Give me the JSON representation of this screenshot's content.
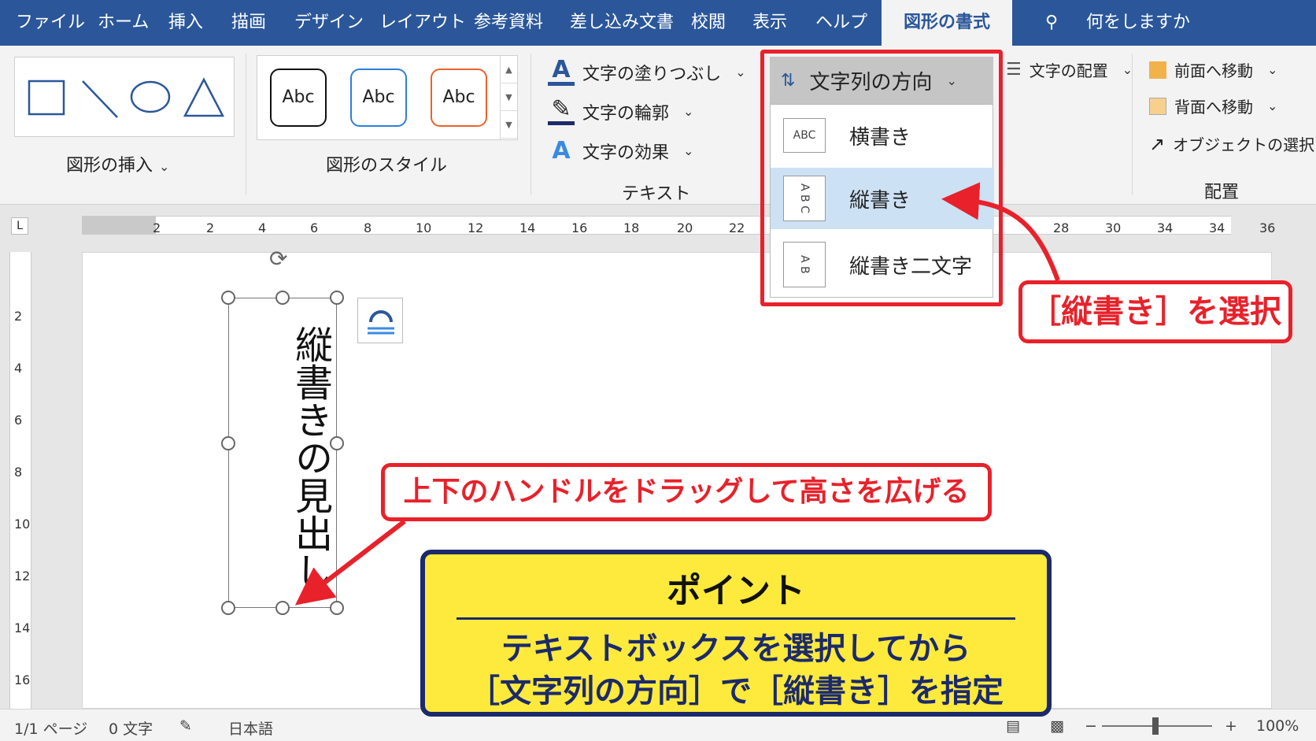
{
  "ribbon_tabs": [
    {
      "label": "ファイル"
    },
    {
      "label": "ホーム"
    },
    {
      "label": "挿入"
    },
    {
      "label": "描画"
    },
    {
      "label": "デザイン"
    },
    {
      "label": "レイアウト"
    },
    {
      "label": "参考資料"
    },
    {
      "label": "差し込み文書"
    },
    {
      "label": "校閲"
    },
    {
      "label": "表示"
    },
    {
      "label": "ヘルプ"
    },
    {
      "label": "図形の書式",
      "active": true
    }
  ],
  "tell_me": "何をしますか",
  "ribbon": {
    "insert_shapes_label": "図形の挿入",
    "shape_styles_label": "図形のスタイル",
    "style_samples": [
      "Abc",
      "Abc",
      "Abc"
    ],
    "text_group_label": "テキスト",
    "text_fill": "文字の塗りつぶし",
    "text_outline": "文字の輪郭",
    "text_effects": "文字の効果",
    "text_direction": "文字列の方向",
    "align_text": "文字の配置",
    "arrange_label": "配置",
    "bring_forward": "前面へ移動",
    "send_backward": "背面へ移動",
    "selection_pane": "オブジェクトの選択"
  },
  "dropdown": {
    "items": [
      {
        "label": "横書き",
        "icon_text": "ABC"
      },
      {
        "label": "縦書き",
        "icon_text": "A B C",
        "selected": true
      },
      {
        "label": "縦書き二文字",
        "icon_text": "A B"
      }
    ]
  },
  "ruler": {
    "h_numbers": [
      "2",
      "2",
      "4",
      "6",
      "8",
      "10",
      "12",
      "14",
      "16",
      "18",
      "20",
      "22",
      "28",
      "30",
      "34",
      "34",
      "36"
    ],
    "v_numbers": [
      "2",
      "4",
      "6",
      "8",
      "10",
      "12",
      "14",
      "16"
    ],
    "corner": "L"
  },
  "document": {
    "textbox_text": "縦書きの見出し"
  },
  "callouts": {
    "select_vertical": "［縦書き］を選択",
    "drag_handles": "上下のハンドルをドラッグして高さを広げる",
    "point_title": "ポイント",
    "point_line1": "テキストボックスを選択してから",
    "point_line2": "［文字列の方向］で［縦書き］を指定"
  },
  "status_bar": {
    "page": "1/1 ページ",
    "words": "0 文字",
    "language": "日本語",
    "zoom": "100%"
  },
  "colors": {
    "ribbon_blue": "#2b579a",
    "callout_red": "#e8212a",
    "point_yellow": "#fdea3c",
    "point_navy": "#1c2a6b",
    "selected_item": "#cde1f5"
  }
}
